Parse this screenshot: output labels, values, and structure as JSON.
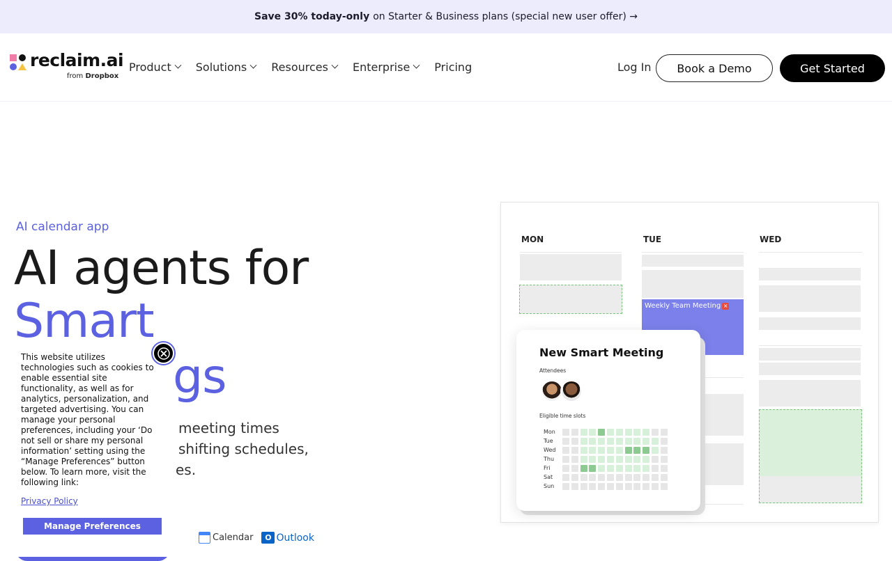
{
  "promo": {
    "bold": "Save 30% today-only",
    "text": "on Starter & Business plans (special new user offer) →"
  },
  "header": {
    "logo_word": "reclaim.ai",
    "logo_from": "from",
    "logo_brand": "Dropbox",
    "nav": [
      {
        "label": "Product"
      },
      {
        "label": "Solutions"
      },
      {
        "label": "Resources"
      },
      {
        "label": "Enterprise"
      },
      {
        "label": "Pricing"
      }
    ],
    "login": "Log In",
    "demo": "Book a Demo",
    "start": "Get Started"
  },
  "hero": {
    "eyebrow": "AI calendar app",
    "line1": "AI agents for",
    "line2": "Smart",
    "line3": "gs",
    "sub1": "meeting times",
    "sub2": "shifting schedules,",
    "sub3": "es."
  },
  "integrations": {
    "gcal": "Calendar",
    "outlook": "Outlook"
  },
  "calendar": {
    "days": [
      "MON",
      "TUE",
      "WED"
    ],
    "weekly": "Weekly Team Meeting",
    "modal_title": "New Smart Meeting",
    "attendees": "Attendees",
    "slots_label": "Eligible time slots",
    "grid_days": [
      "Mon",
      "Tue",
      "Wed",
      "Thu",
      "Fri",
      "Sat",
      "Sun"
    ]
  },
  "cookie": {
    "text": "This website utilizes technologies such as cookies to enable essential site functionality, as well as for analytics, personalization, and targeted advertising. You can manage your personal preferences, including your ‘Do not sell or share my personal information’ setting using the “Manage Preferences” button below. To learn more, visit the following link:",
    "link": "Privacy Policy",
    "button": "Manage Preferences"
  },
  "colors": {
    "accent": "#5b61e0",
    "promo_bg": "#ececfd",
    "meeting": "#7b80ea",
    "slot_green": "#7cc47c"
  }
}
